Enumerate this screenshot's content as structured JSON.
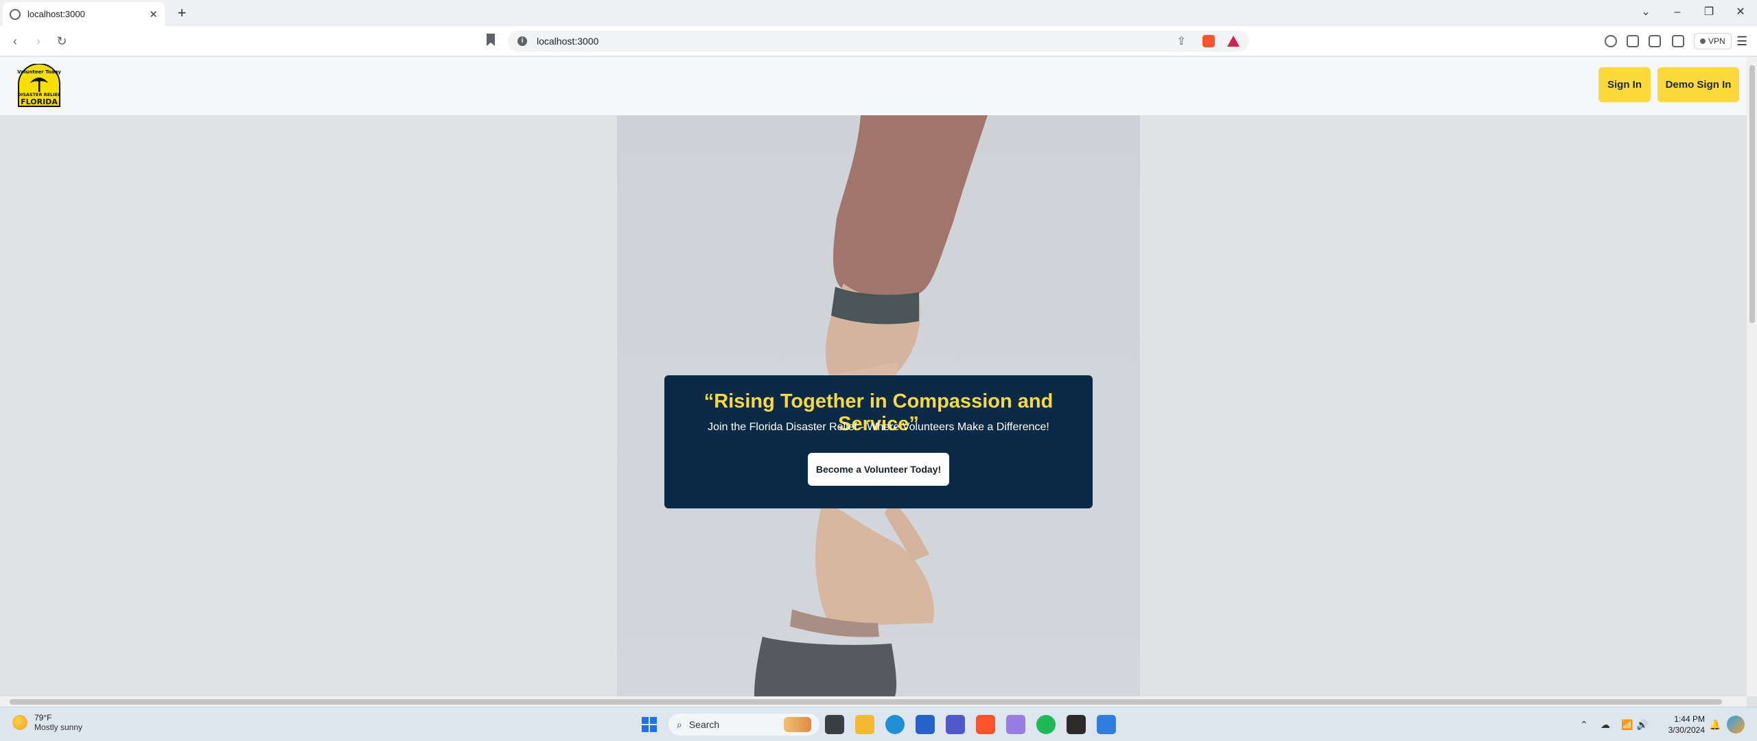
{
  "browser": {
    "tab_title": "localhost:3000",
    "tab_close": "✕",
    "new_tab": "+",
    "url": "localhost:3000",
    "vpn_label": "VPN"
  },
  "site": {
    "sign_in": "Sign In",
    "demo_sign_in": "Demo Sign In",
    "logo_alt_top": "Volunteer Today",
    "logo_alt_mid": "DISASTER RELIEF",
    "logo_alt_bottom": "FLORIDA"
  },
  "hero": {
    "title": "“Rising Together in Compassion and Service”",
    "subtitle": "Join the Florida Disaster Relief - Where Volunteers Make a Difference!",
    "cta": "Become a Volunteer Today!"
  },
  "taskbar": {
    "temperature": "79°F",
    "condition": "Mostly sunny",
    "search_placeholder": "Search",
    "time": "1:44 PM",
    "date": "3/30/2024"
  },
  "colors": {
    "accent_yellow": "#fbd93b",
    "card_navy": "#0a2a47"
  }
}
